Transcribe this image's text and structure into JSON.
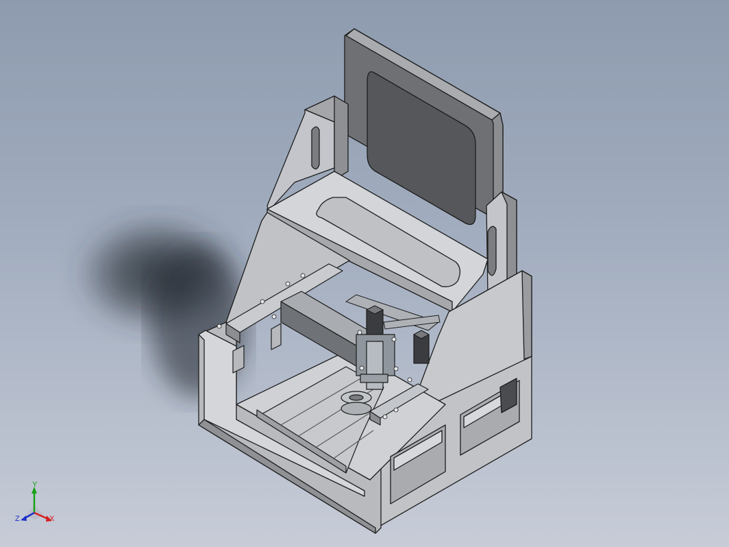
{
  "viewport": {
    "background_top": "#8e9bae",
    "background_bottom": "#c7ccd7"
  },
  "model": {
    "type": "cnc-router-enclosure-assembly",
    "parts": [
      "display-panel",
      "shelf",
      "side-brackets",
      "base-enclosure",
      "gantry-beam",
      "spindle-assembly",
      "stepper-motor",
      "t-slot-table"
    ],
    "colors": {
      "body_light": "#c4c6cb",
      "body_mid": "#a8aaae",
      "body_dark": "#6f7175",
      "screen": "#5a5c5f",
      "metal": "#8f969d",
      "motor": "#3a3c3f"
    }
  },
  "triad": {
    "x_label": "X",
    "y_label": "Y",
    "z_label": "Z",
    "x_color": "#d42020",
    "y_color": "#18a018",
    "z_color": "#2030c8"
  }
}
